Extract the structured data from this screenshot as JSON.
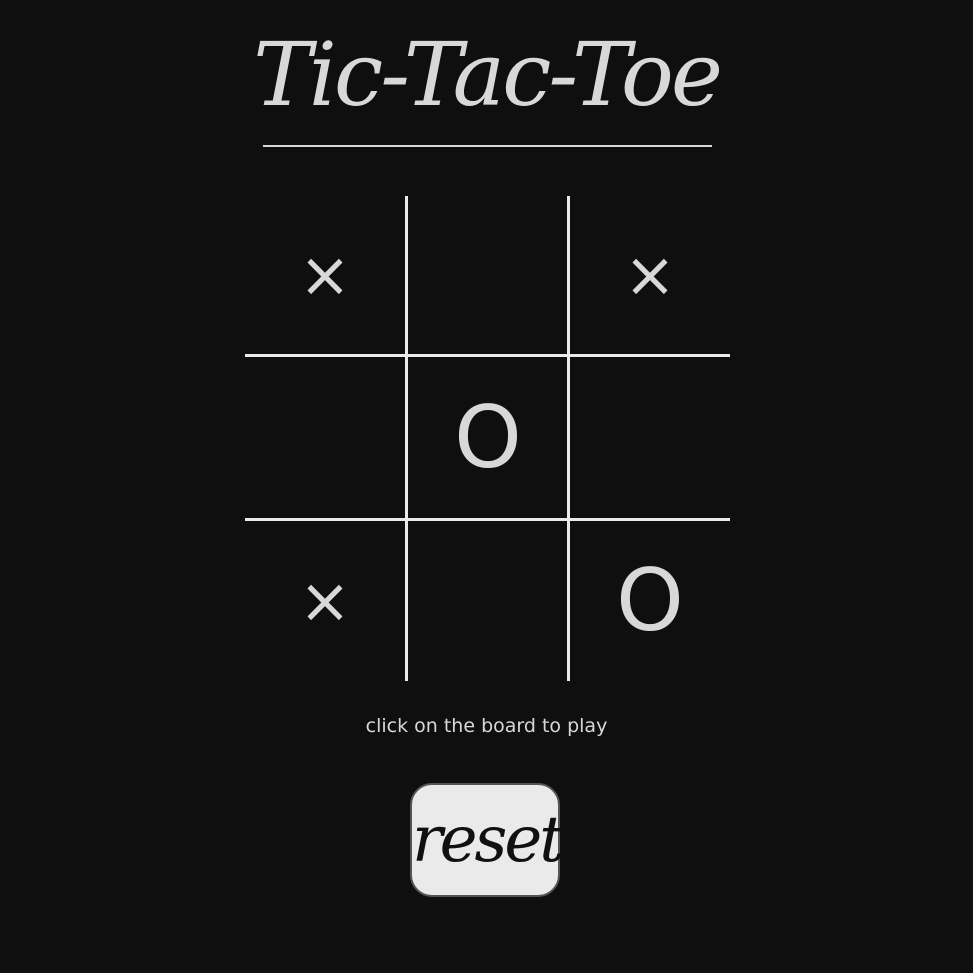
{
  "title": "Tic-Tac-Toe",
  "board": [
    [
      "×",
      "",
      "×"
    ],
    [
      "",
      "O",
      ""
    ],
    [
      "×",
      "",
      "O"
    ]
  ],
  "status": "click on the board to play",
  "reset_label": "reset",
  "colors": {
    "background": "#0f0f0f",
    "foreground": "#d8d8d8",
    "grid": "#eaeaea",
    "button_bg": "#eaeaea",
    "button_text": "#111111"
  }
}
